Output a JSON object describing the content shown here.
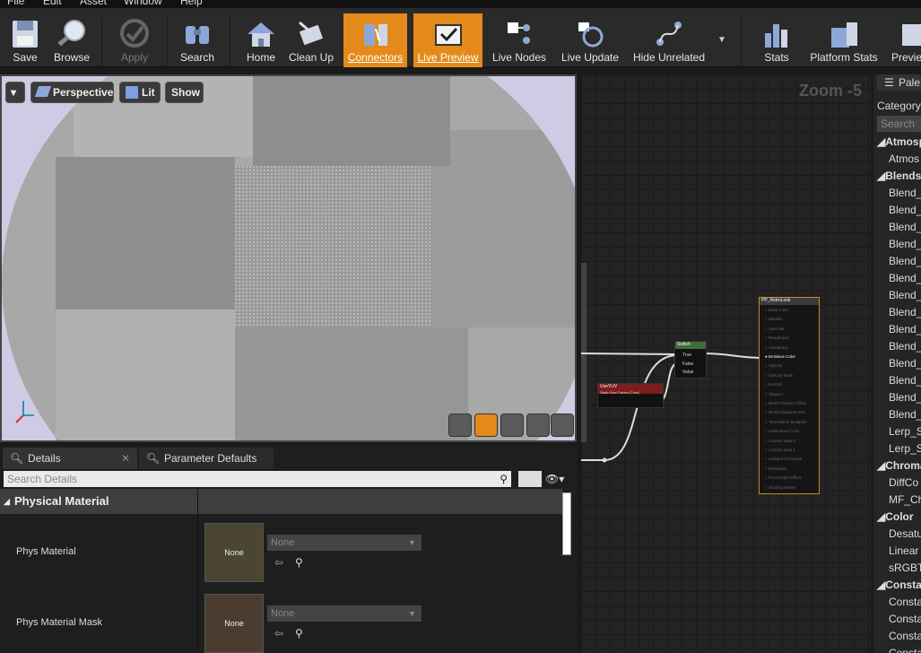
{
  "menu": [
    "File",
    "Edit",
    "Asset",
    "Window",
    "Help"
  ],
  "toolbar": {
    "save": "Save",
    "browse": "Browse",
    "apply": "Apply",
    "search": "Search",
    "home": "Home",
    "cleanup": "Clean Up",
    "connectors": "Connectors",
    "live_preview": "Live Preview",
    "live_nodes": "Live Nodes",
    "live_update": "Live Update",
    "hide_unrelated": "Hide Unrelated",
    "stats": "Stats",
    "platform_stats": "Platform Stats",
    "preview": "Previe"
  },
  "viewport": {
    "perspective": "Perspective",
    "lit": "Lit",
    "show": "Show"
  },
  "details": {
    "tab1": "Details",
    "tab2": "Parameter Defaults",
    "search_placeholder": "Search Details",
    "section": "Physical Material",
    "prop1": "Phys Material",
    "prop2": "Phys Material Mask",
    "none": "None"
  },
  "graph": {
    "zoom": "Zoom -5",
    "switch_title": "Switch",
    "switch_pins": [
      "True",
      "False",
      "Value"
    ],
    "param_title": "UseYUV",
    "param_sub": "Static Bool Param (True)",
    "result_title": "PP_RetroLook",
    "result_pins": [
      "Base Color",
      "Metallic",
      "Specular",
      "Roughness",
      "Anisotropy",
      "Emissive Color",
      "Opacity",
      "Opacity Mask",
      "Normal",
      "Tangent",
      "World Position Offset",
      "World Displacement",
      "Tessellation Multiplier",
      "Subsurface Color",
      "Custom Data 0",
      "Custom Data 1",
      "Ambient Occlusion",
      "Refraction",
      "Pixel Depth Offset",
      "Shading Model"
    ]
  },
  "palette": {
    "title": "Pale",
    "category": "Category",
    "search": "Search",
    "rows": [
      {
        "t": "Atmosp",
        "cat": true
      },
      {
        "t": "Atmos",
        "cat": false
      },
      {
        "t": "Blends",
        "cat": true
      },
      {
        "t": "Blend_",
        "cat": false
      },
      {
        "t": "Blend_",
        "cat": false
      },
      {
        "t": "Blend_",
        "cat": false
      },
      {
        "t": "Blend_",
        "cat": false
      },
      {
        "t": "Blend_",
        "cat": false
      },
      {
        "t": "Blend_",
        "cat": false
      },
      {
        "t": "Blend_",
        "cat": false
      },
      {
        "t": "Blend_",
        "cat": false
      },
      {
        "t": "Blend_",
        "cat": false
      },
      {
        "t": "Blend_",
        "cat": false
      },
      {
        "t": "Blend_",
        "cat": false
      },
      {
        "t": "Blend_",
        "cat": false
      },
      {
        "t": "Blend_",
        "cat": false
      },
      {
        "t": "Blend_",
        "cat": false
      },
      {
        "t": "Lerp_S",
        "cat": false
      },
      {
        "t": "Lerp_S",
        "cat": false
      },
      {
        "t": "Chroma",
        "cat": true
      },
      {
        "t": "DiffCo",
        "cat": false
      },
      {
        "t": "MF_Ch",
        "cat": false
      },
      {
        "t": "Color",
        "cat": true
      },
      {
        "t": "Desatu",
        "cat": false
      },
      {
        "t": "Linear",
        "cat": false
      },
      {
        "t": "sRGBT",
        "cat": false
      },
      {
        "t": "Consta",
        "cat": true
      },
      {
        "t": "Consta",
        "cat": false
      },
      {
        "t": "Consta",
        "cat": false
      },
      {
        "t": "Consta",
        "cat": false
      },
      {
        "t": "Consta",
        "cat": false
      }
    ]
  },
  "colors": {
    "accent": "#e48a1a",
    "viewport_bg": "#cfcbe4"
  }
}
